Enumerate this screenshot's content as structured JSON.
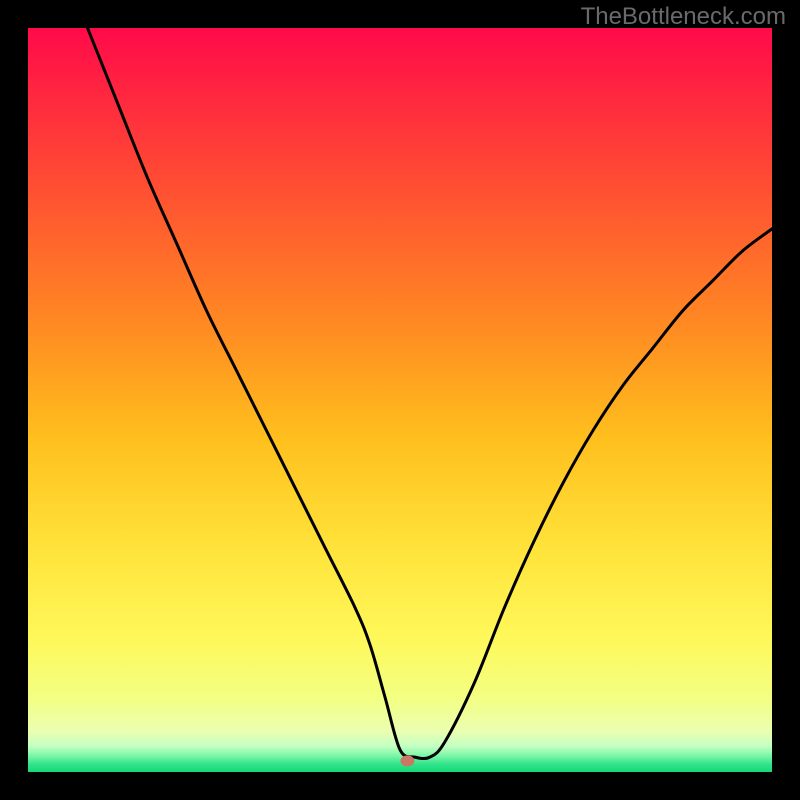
{
  "watermark": "TheBottleneck.com",
  "chart_data": {
    "type": "line",
    "title": "",
    "xlabel": "",
    "ylabel": "",
    "xlim": [
      0,
      100
    ],
    "ylim": [
      0,
      100
    ],
    "grid": false,
    "legend": false,
    "marker": {
      "x": 51,
      "y": 1.5,
      "color": "#cc7766"
    },
    "series": [
      {
        "name": "curve",
        "x": [
          8,
          12,
          16,
          20,
          24,
          28,
          32,
          36,
          40,
          44,
          46,
          48,
          50,
          52,
          54,
          56,
          60,
          64,
          68,
          72,
          76,
          80,
          84,
          88,
          92,
          96,
          100
        ],
        "y": [
          100,
          90,
          80,
          71,
          62,
          54,
          46,
          38,
          30,
          22,
          17,
          10,
          3,
          2,
          2,
          4,
          12,
          22,
          31,
          39,
          46,
          52,
          57,
          62,
          66,
          70,
          73
        ]
      }
    ],
    "gradient_stops": [
      {
        "offset": 0.0,
        "color": "#ff0a4a"
      },
      {
        "offset": 0.1,
        "color": "#ff2a3e"
      },
      {
        "offset": 0.25,
        "color": "#ff5a2f"
      },
      {
        "offset": 0.4,
        "color": "#ff8a22"
      },
      {
        "offset": 0.55,
        "color": "#ffbf1d"
      },
      {
        "offset": 0.7,
        "color": "#ffe33a"
      },
      {
        "offset": 0.82,
        "color": "#fff85a"
      },
      {
        "offset": 0.9,
        "color": "#f3ff82"
      },
      {
        "offset": 0.945,
        "color": "#eaffb0"
      },
      {
        "offset": 0.965,
        "color": "#c5ffc3"
      },
      {
        "offset": 0.978,
        "color": "#7cf6a8"
      },
      {
        "offset": 0.99,
        "color": "#2fe38a"
      },
      {
        "offset": 1.0,
        "color": "#14d977"
      }
    ]
  }
}
